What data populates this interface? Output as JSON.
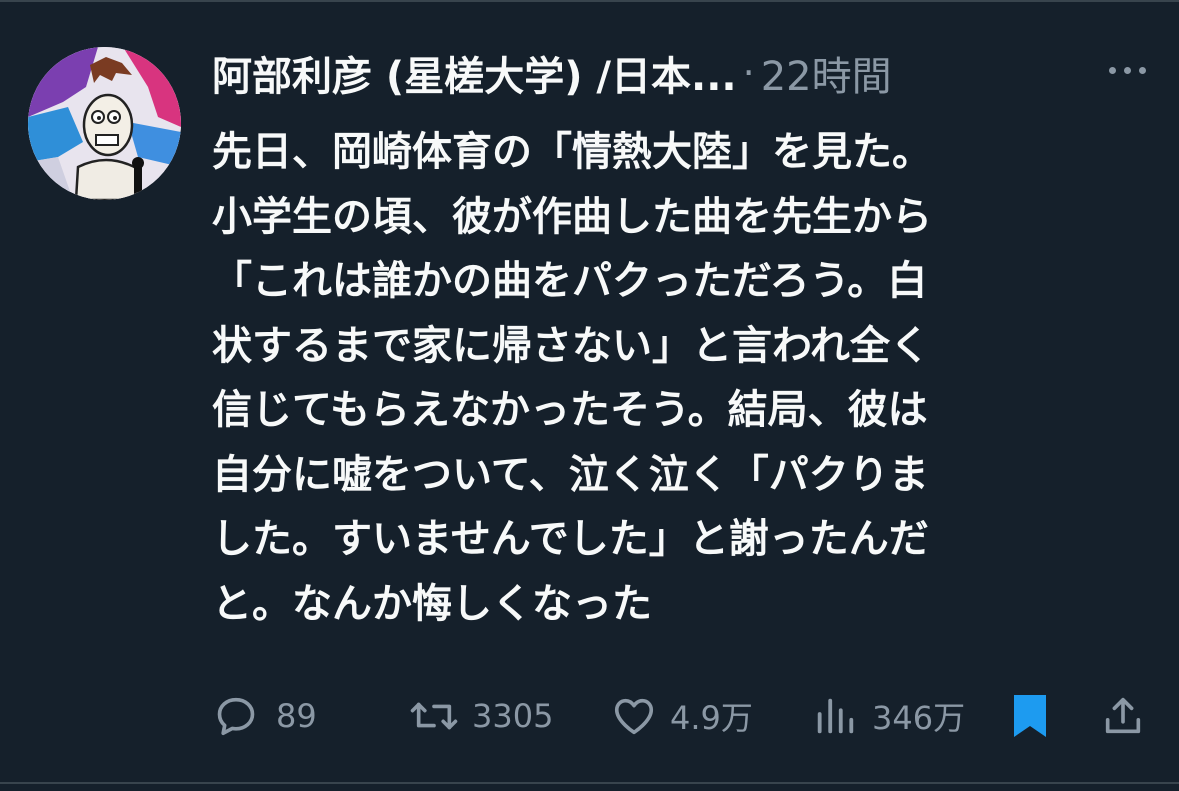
{
  "tweet": {
    "display_name": "阿部利彦 (星槎大学) /日本...",
    "separator": "·",
    "timestamp": "22時間",
    "lines": [
      "先日、岡崎体育の「情熱大陸」を見た。",
      "小学生の頃、彼が作曲した曲を先生から",
      "「これは誰かの曲をパクっただろう。白",
      "状するまで家に帰さない」と言われ全く",
      "信じてもらえなかったそう。結局、彼は",
      "自分に嘘をついて、泣く泣く「パクりま",
      "した。すいませんでした」と謝ったんだ",
      "と。なんか悔しくなった"
    ]
  },
  "actions": {
    "replies": "89",
    "retweets": "3305",
    "likes": "4.9万",
    "views": "346万"
  },
  "icons": {
    "reply": "reply-icon",
    "retweet": "retweet-icon",
    "like": "heart-icon",
    "views": "views-icon",
    "bookmark": "bookmark-icon",
    "share": "share-icon",
    "more": "more-icon"
  },
  "colors": {
    "background": "#15202b",
    "text": "#f7f9f9",
    "secondary": "#8b98a5",
    "bookmark_active": "#1d9bf0"
  }
}
